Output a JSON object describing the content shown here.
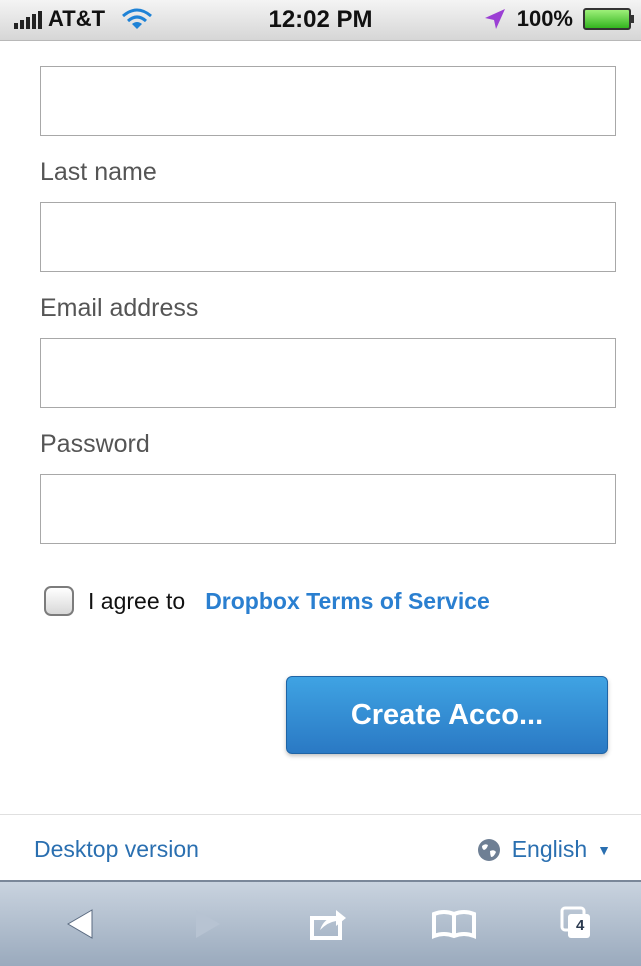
{
  "status_bar": {
    "carrier": "AT&T",
    "time": "12:02 PM",
    "battery": "100%"
  },
  "form": {
    "fields": [
      {
        "label": "",
        "value": ""
      },
      {
        "label": "Last name",
        "value": ""
      },
      {
        "label": "Email address",
        "value": ""
      },
      {
        "label": "Password",
        "value": ""
      }
    ],
    "agree_text": "I agree to",
    "terms_link": "Dropbox Terms of Service",
    "submit_label": "Create Acco..."
  },
  "footer": {
    "desktop_link": "Desktop version",
    "language": "English"
  },
  "toolbar": {
    "tabs_count": "4",
    "icons": [
      "back-icon",
      "forward-icon",
      "share-icon",
      "bookmarks-icon",
      "tabs-icon"
    ]
  }
}
